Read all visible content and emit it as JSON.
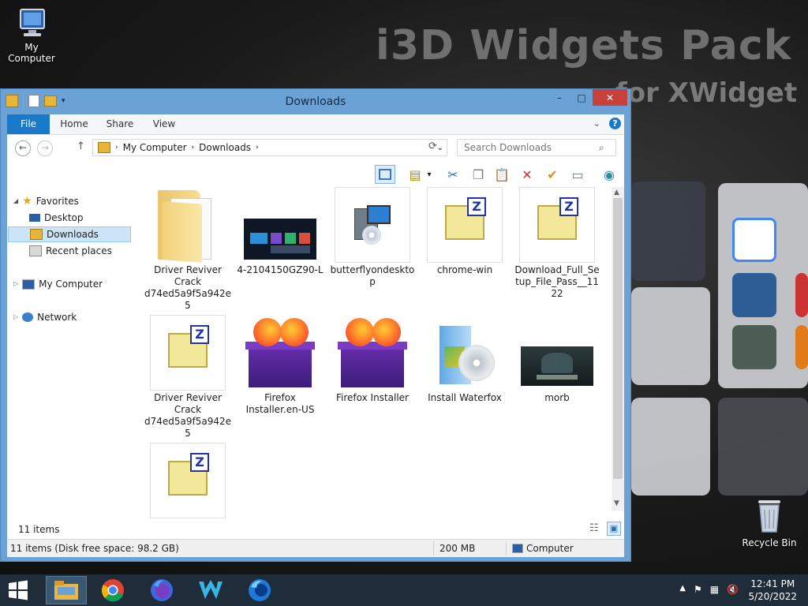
{
  "desktop": {
    "brand_line1": "i3D Widgets Pack",
    "brand_line2": "for XWidget",
    "icons": [
      {
        "label": "My Computer",
        "icon": "computer-icon"
      },
      {
        "label": "Recycle Bin",
        "icon": "recycle-bin-icon"
      }
    ]
  },
  "window": {
    "title": "Downloads",
    "controls": {
      "minimize": "–",
      "maximize": "□",
      "close": "✕"
    },
    "ribbon_tabs": [
      "File",
      "Home",
      "Share",
      "View"
    ],
    "address": {
      "root": "My Computer",
      "current": "Downloads"
    },
    "search_placeholder": "Search Downloads",
    "nav": {
      "favorites": "Favorites",
      "desktop": "Desktop",
      "downloads": "Downloads",
      "recent": "Recent places",
      "computer": "My Computer",
      "network": "Network"
    },
    "files": [
      {
        "name": "Driver Reviver Crack d74ed5a9f5a942e5",
        "type": "folder"
      },
      {
        "name": "4-2104150GZ90-L",
        "type": "image"
      },
      {
        "name": "butterflyondesktop",
        "type": "installer"
      },
      {
        "name": "chrome-win",
        "type": "zip"
      },
      {
        "name": "Download_Full_Setup_File_Pass__1122",
        "type": "zip"
      },
      {
        "name": "Driver Reviver Crack d74ed5a9f5a942e5",
        "type": "zip"
      },
      {
        "name": "Firefox Installer.en-US",
        "type": "firefox"
      },
      {
        "name": "Firefox Installer",
        "type": "firefox"
      },
      {
        "name": "Install Waterfox",
        "type": "setup"
      },
      {
        "name": "morb",
        "type": "video"
      },
      {
        "name": "",
        "type": "zip"
      }
    ],
    "items_count": "11 items",
    "status": {
      "summary": "11 items (Disk free space: 98.2 GB)",
      "size": "200 MB",
      "location": "Computer"
    }
  },
  "taskbar": {
    "time": "12:41 PM",
    "date": "5/20/2022",
    "apps": [
      "start-icon",
      "file-explorer-icon",
      "chrome-icon",
      "firefox-icon",
      "waterfox-icon",
      "firefox-nightly-icon"
    ]
  },
  "colors": {
    "accent": "#1979ca",
    "window_frame": "#6aa2d6",
    "close": "#c7413a",
    "taskbar": "#1f2d3a"
  }
}
